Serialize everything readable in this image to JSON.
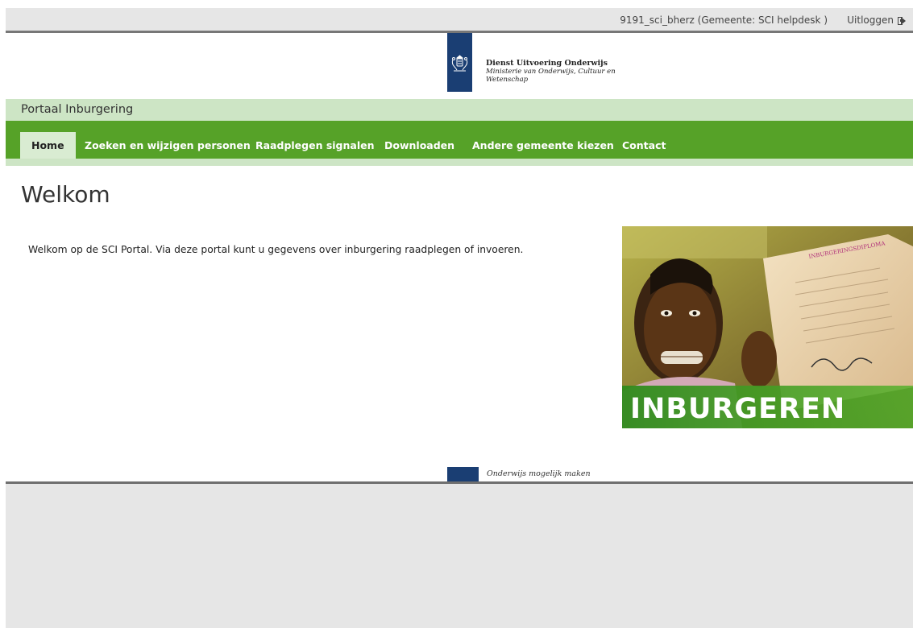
{
  "header": {
    "user_info": "9191_sci_bherz (Gemeente: SCI helpdesk )",
    "logout_label": "Uitloggen"
  },
  "logo": {
    "line1": "Dienst Uitvoering Onderwijs",
    "line2": "Ministerie van Onderwijs, Cultuur en",
    "line3": "Wetenschap"
  },
  "portal_title": "Portaal Inburgering",
  "nav": {
    "items": [
      {
        "label": "Home",
        "active": true
      },
      {
        "label": "Zoeken en wijzigen personen"
      },
      {
        "label": "Raadplegen signalen"
      },
      {
        "label": "Downloaden"
      },
      {
        "label": "Andere gemeente kiezen"
      },
      {
        "label": "Contact"
      }
    ]
  },
  "main": {
    "title": "Welkom",
    "intro": "Welkom op de SCI Portal. Via deze portal kunt u gegevens over inburgering raadplegen of invoeren.",
    "image_label": "INBURGEREN",
    "diploma_title": "INBURGERINGSDIPLOMA"
  },
  "footer": {
    "tagline": "Onderwijs mogelijk maken"
  },
  "colors": {
    "nav_green": "#56a228",
    "light_green": "#cde5c5",
    "rijks_blue": "#1a3e73",
    "top_gray": "#e6e6e6"
  }
}
